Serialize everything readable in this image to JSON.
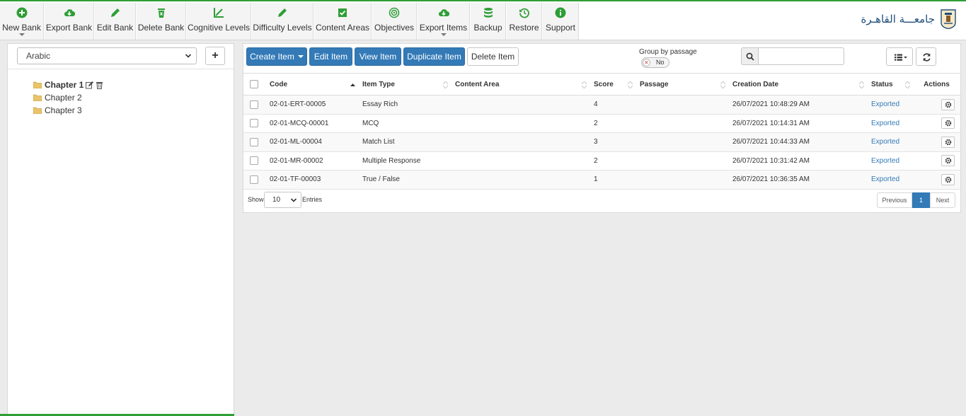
{
  "toolbar": {
    "items": [
      {
        "label": "New Bank",
        "icon": "plus-circle-icon"
      },
      {
        "label": "Export Bank",
        "icon": "cloud-download-icon"
      },
      {
        "label": "Edit Bank",
        "icon": "pencil-icon"
      },
      {
        "label": "Delete Bank",
        "icon": "trash-icon"
      },
      {
        "label": "Cognitive Levels",
        "icon": "chart-line-icon"
      },
      {
        "label": "Difficulty Levels",
        "icon": "pencil-icon"
      },
      {
        "label": "Content Areas",
        "icon": "check-square-icon"
      },
      {
        "label": "Objectives",
        "icon": "target-icon"
      },
      {
        "label": "Export Items",
        "icon": "cloud-download-icon"
      },
      {
        "label": "Backup",
        "icon": "database-icon"
      },
      {
        "label": "Restore",
        "icon": "history-icon"
      },
      {
        "label": "Support",
        "icon": "info-circle-icon"
      }
    ],
    "accent_color": "#2e9e36"
  },
  "brand": {
    "name": "جامعـــة القاهـرة"
  },
  "left_panel": {
    "language": "Arabic",
    "add_label": "+",
    "chapters": [
      {
        "label": "Chapter 1",
        "active": true
      },
      {
        "label": "Chapter 2",
        "active": false
      },
      {
        "label": "Chapter 3",
        "active": false
      }
    ]
  },
  "actions": {
    "create_item": "Create Item",
    "edit_item": "Edit Item",
    "view_item": "View Item",
    "duplicate_item": "Duplicate Item",
    "delete_item": "Delete Item",
    "primary_color": "#337ab7"
  },
  "group_by_passage": {
    "label": "Group by passage",
    "toggle_text": "No",
    "value": false
  },
  "search": {
    "placeholder": "",
    "value": ""
  },
  "table": {
    "columns": [
      "Code",
      "Item Type",
      "Content Area",
      "Score",
      "Passage",
      "Creation Date",
      "Status",
      "Actions"
    ],
    "rows": [
      {
        "code": "02-01-ERT-00005",
        "item_type": "Essay Rich",
        "content_area": "",
        "score": "4",
        "passage": "",
        "creation_date": "26/07/2021 10:48:29 AM",
        "status": "Exported"
      },
      {
        "code": "02-01-MCQ-00001",
        "item_type": "MCQ",
        "content_area": "",
        "score": "2",
        "passage": "",
        "creation_date": "26/07/2021 10:14:31 AM",
        "status": "Exported"
      },
      {
        "code": "02-01-ML-00004",
        "item_type": "Match List",
        "content_area": "",
        "score": "3",
        "passage": "",
        "creation_date": "26/07/2021 10:44:33 AM",
        "status": "Exported"
      },
      {
        "code": "02-01-MR-00002",
        "item_type": "Multiple Response",
        "content_area": "",
        "score": "2",
        "passage": "",
        "creation_date": "26/07/2021 10:31:42 AM",
        "status": "Exported"
      },
      {
        "code": "02-01-TF-00003",
        "item_type": "True / False",
        "content_area": "",
        "score": "1",
        "passage": "",
        "creation_date": "26/07/2021 10:36:35 AM",
        "status": "Exported"
      }
    ]
  },
  "footer": {
    "show_label": "Show",
    "page_size": "10",
    "entries_label": "Entries",
    "previous": "Previous",
    "current_page": "1",
    "next": "Next"
  }
}
